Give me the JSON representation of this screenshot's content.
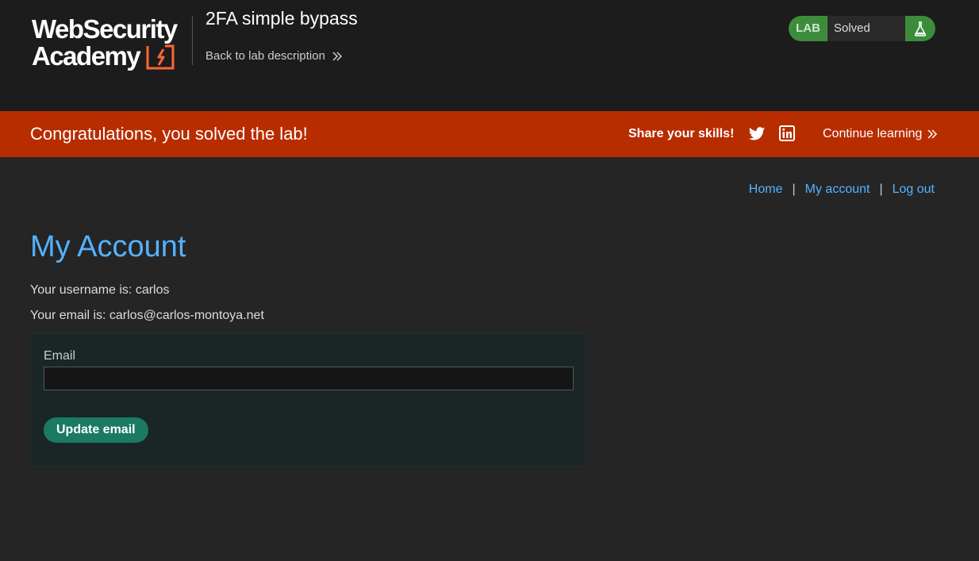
{
  "header": {
    "logo_line1": "WebSecurity",
    "logo_line2": "Academy",
    "lab_title": "2FA simple bypass",
    "back_link": "Back to lab description"
  },
  "lab_badge": {
    "tag": "LAB",
    "status": "Solved"
  },
  "banner": {
    "congrats": "Congratulations, you solved the lab!",
    "share": "Share your skills!",
    "continue": "Continue learning"
  },
  "nav": {
    "home": "Home",
    "sep1": "|",
    "my_account": "My account",
    "sep2": "|",
    "logout": "Log out"
  },
  "account": {
    "title": "My Account",
    "username_line": "Your username is: carlos",
    "email_line": "Your email is: carlos@carlos-montoya.net"
  },
  "form": {
    "email_label": "Email",
    "email_value": "",
    "update_button": "Update email"
  },
  "colors": {
    "banner": "#b72d00",
    "lab_badge": "#3c8c3c",
    "link": "#54b2ff",
    "button": "#1a7a62"
  },
  "icons": [
    "flask-icon",
    "twitter-icon",
    "linkedin-icon",
    "chevron-right-icon"
  ]
}
